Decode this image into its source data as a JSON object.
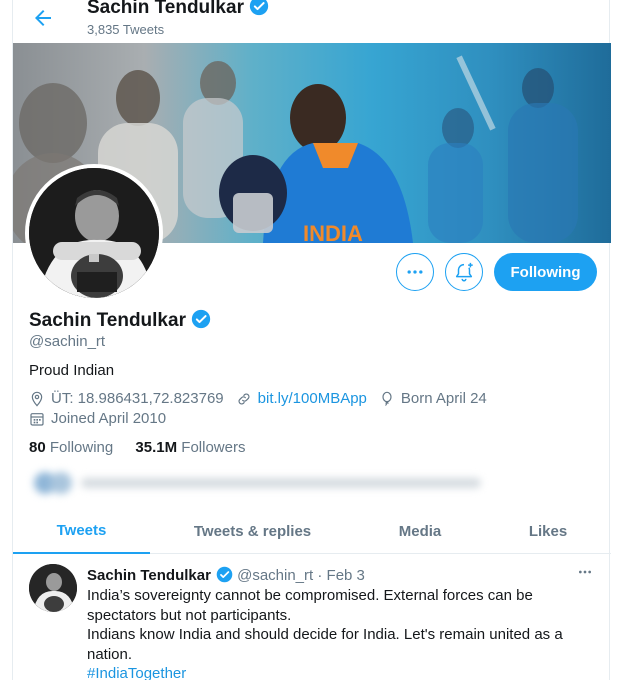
{
  "header": {
    "name": "Sachin Tendulkar",
    "tweet_count": "3,835 Tweets"
  },
  "actions": {
    "follow_label": "Following"
  },
  "profile": {
    "name": "Sachin Tendulkar",
    "handle": "@sachin_rt",
    "bio": "Proud Indian",
    "location": "ÜT: 18.986431,72.823769",
    "website": "bit.ly/100MBApp",
    "birthday": "Born April 24",
    "joined": "Joined April 2010",
    "following_count": "80",
    "following_label": "Following",
    "followers_count": "35.1M",
    "followers_label": "Followers"
  },
  "tabs": [
    {
      "label": "Tweets"
    },
    {
      "label": "Tweets & replies"
    },
    {
      "label": "Media"
    },
    {
      "label": "Likes"
    }
  ],
  "tweet": {
    "name": "Sachin Tendulkar",
    "handle": "@sachin_rt",
    "separator": "·",
    "date": "Feb 3",
    "line1": "India’s sovereignty cannot be compromised. External forces can be spectators but not participants.",
    "line2": "Indians know India and should decide for India. Let's remain united as a nation.",
    "hashtag": "#IndiaTogether"
  },
  "icons": {
    "back": "arrow-left-icon",
    "verified": "verified-badge-icon",
    "more": "more-horizontal-icon",
    "notify": "bell-plus-icon",
    "location": "location-pin-icon",
    "link": "link-icon",
    "birthday": "balloon-icon",
    "calendar": "calendar-icon"
  },
  "colors": {
    "accent": "#1da1f2",
    "link": "#1b95e0",
    "muted": "#657786",
    "text": "#14171a",
    "border": "#e6ecf0"
  }
}
